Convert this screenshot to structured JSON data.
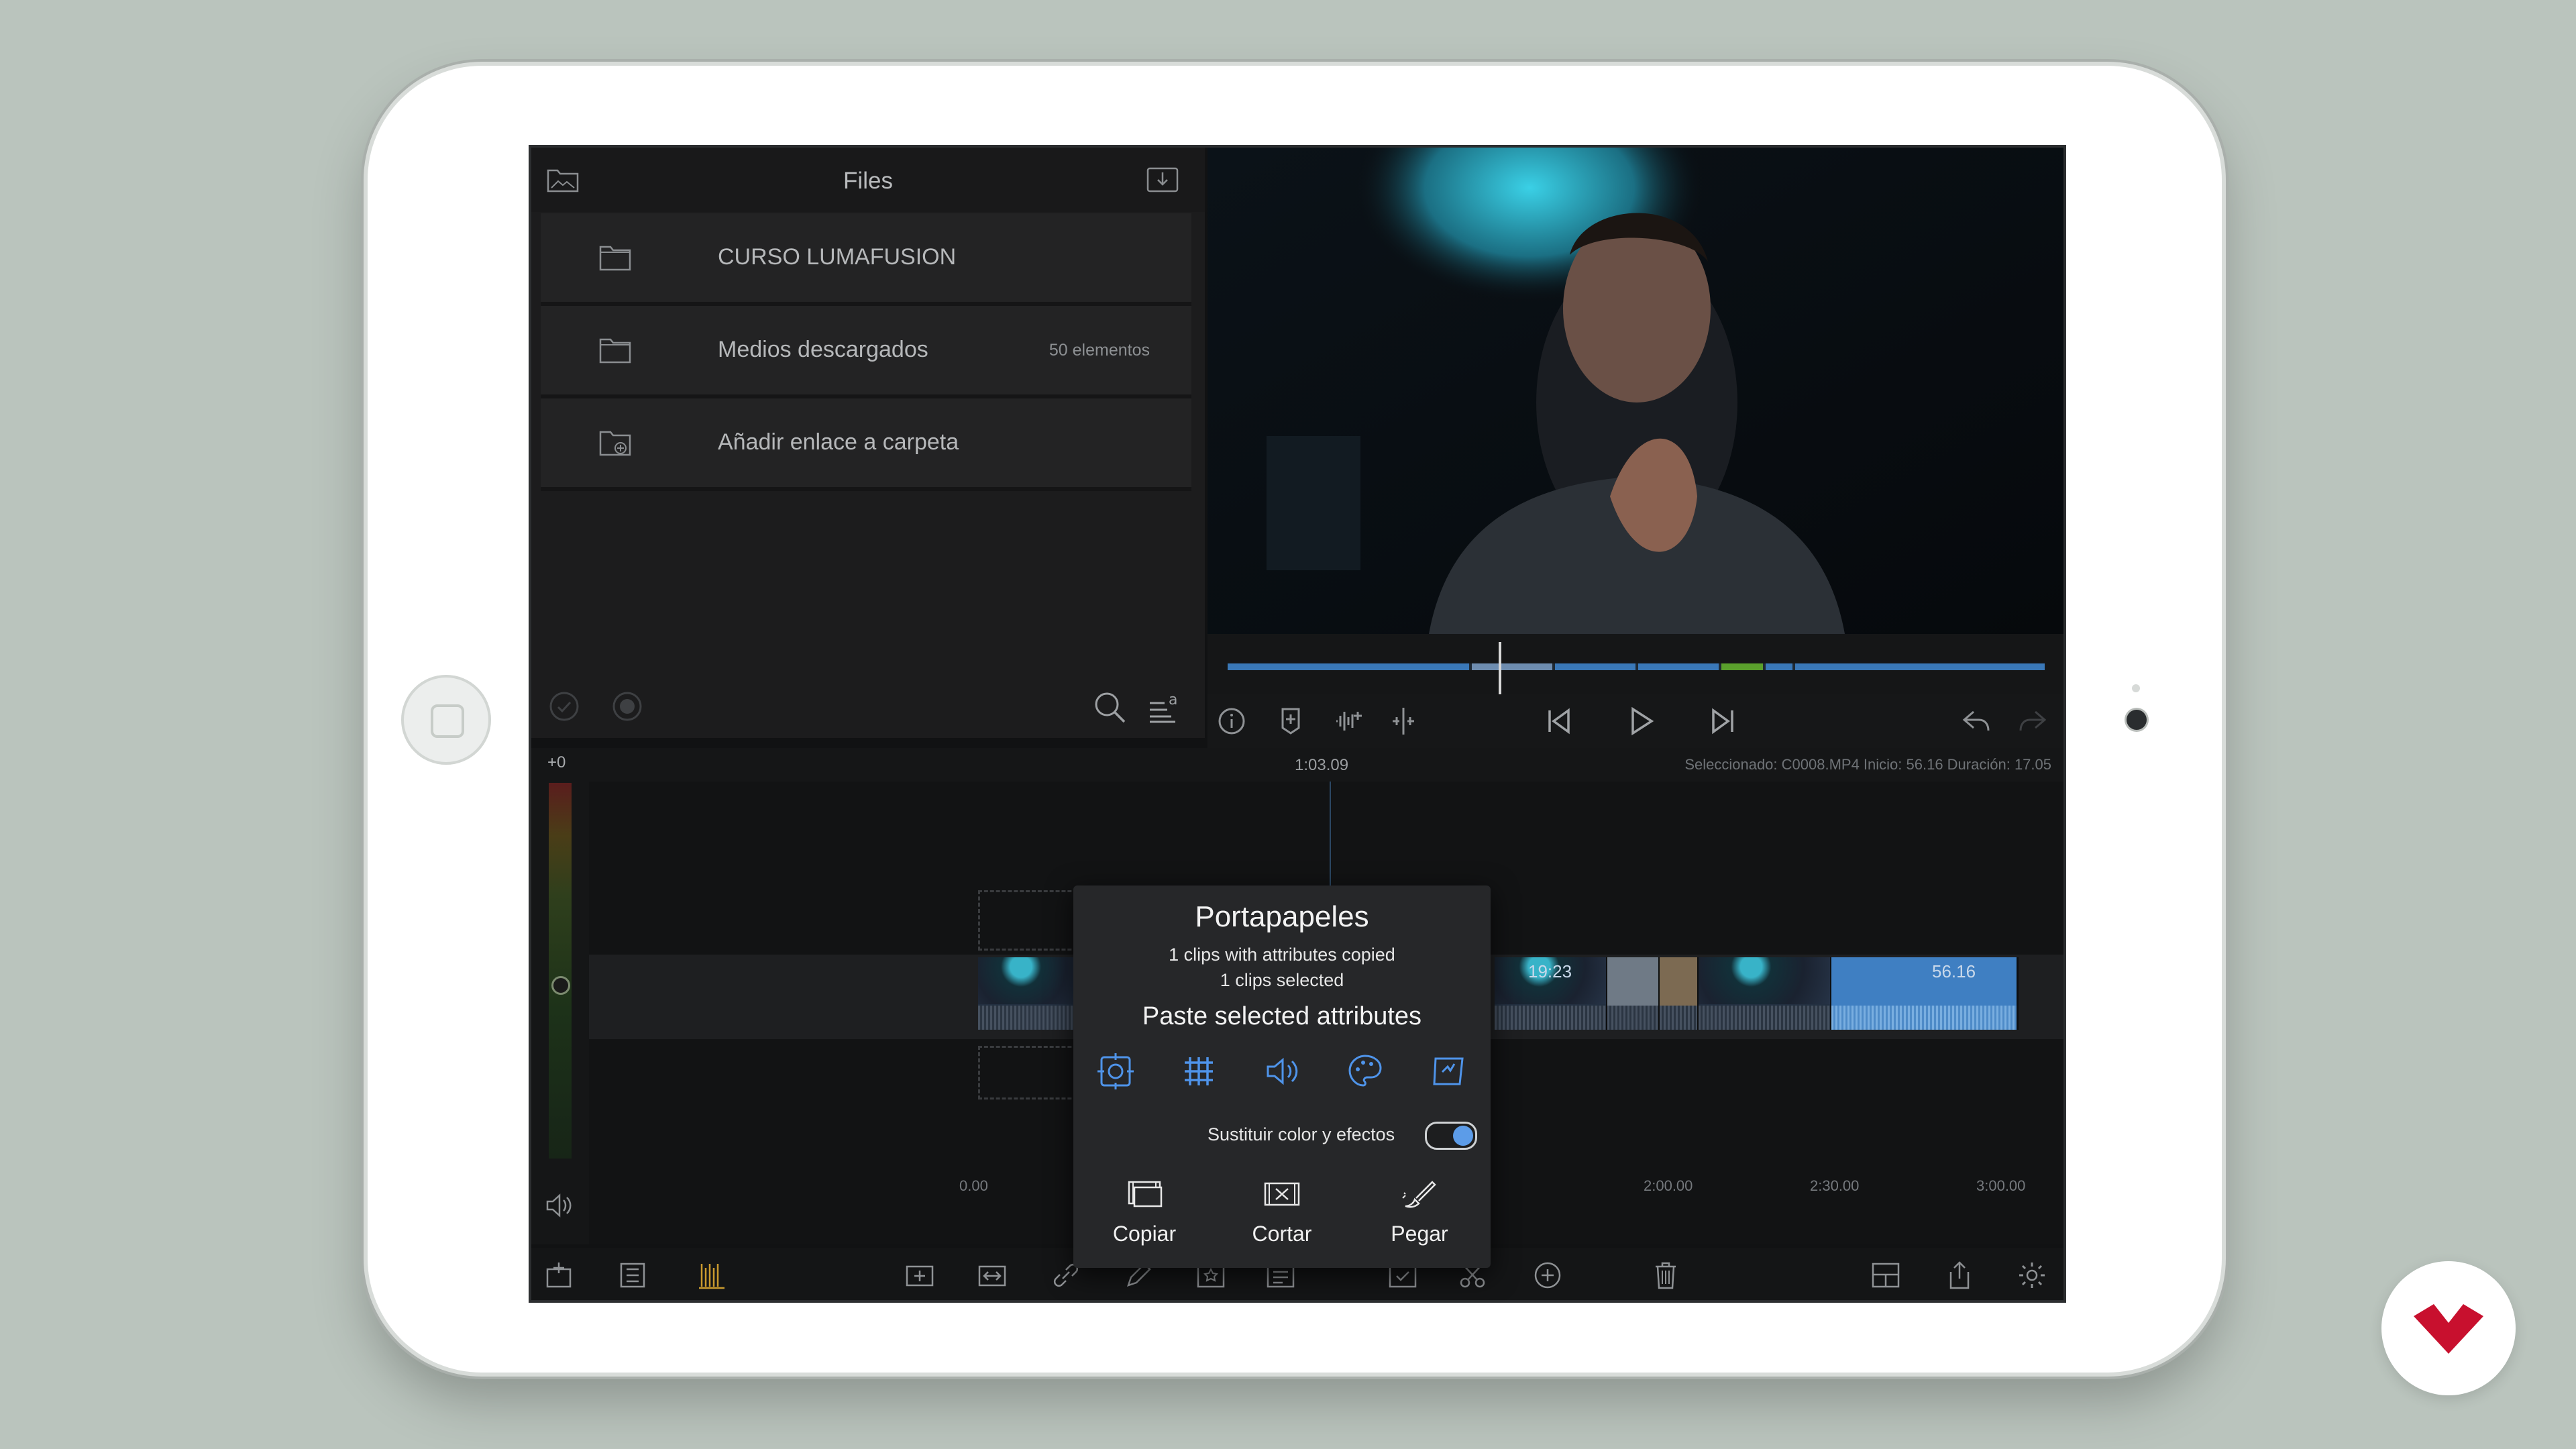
{
  "files": {
    "title": "Files",
    "folders": [
      {
        "label": "CURSO LUMAFUSION",
        "count": ""
      },
      {
        "label": "Medios descargados",
        "count": "50 elementos"
      },
      {
        "label": "Añadir enlace a carpeta",
        "count": ""
      }
    ]
  },
  "timeline": {
    "meter_label": "+0",
    "playhead_time": "1:03.09",
    "selection_info": "Seleccionado: C0008.MP4 Inicio: 56.16 Duración: 17.05",
    "ruler_ticks": [
      "0.00",
      "2:00.00",
      "2:30.00",
      "3:00.00"
    ],
    "clips": [
      {
        "label": ""
      },
      {
        "label": "19:23"
      },
      {
        "label": ""
      },
      {
        "label": ""
      },
      {
        "label": ""
      },
      {
        "label": "56.16"
      }
    ]
  },
  "popover": {
    "title": "Portapapeles",
    "subtitle_line1": "1 clips with attributes copied",
    "subtitle_line2": "1 clips selected",
    "section_title": "Paste selected attributes",
    "attribute_icons": [
      "frame-fit-icon",
      "grid-effects-icon",
      "audio-icon",
      "color-palette-icon",
      "speed-icon"
    ],
    "toggle_label": "Sustituir color y efectos",
    "toggle_on": true,
    "actions": [
      {
        "label": "Copiar",
        "icon": "copy-clip-icon"
      },
      {
        "label": "Cortar",
        "icon": "cut-clip-icon"
      },
      {
        "label": "Pegar",
        "icon": "paste-brush-icon"
      }
    ]
  },
  "colors": {
    "accent": "#3f7fc2",
    "toggle_on": "#5c9ce8",
    "brand": "#c8102e"
  }
}
